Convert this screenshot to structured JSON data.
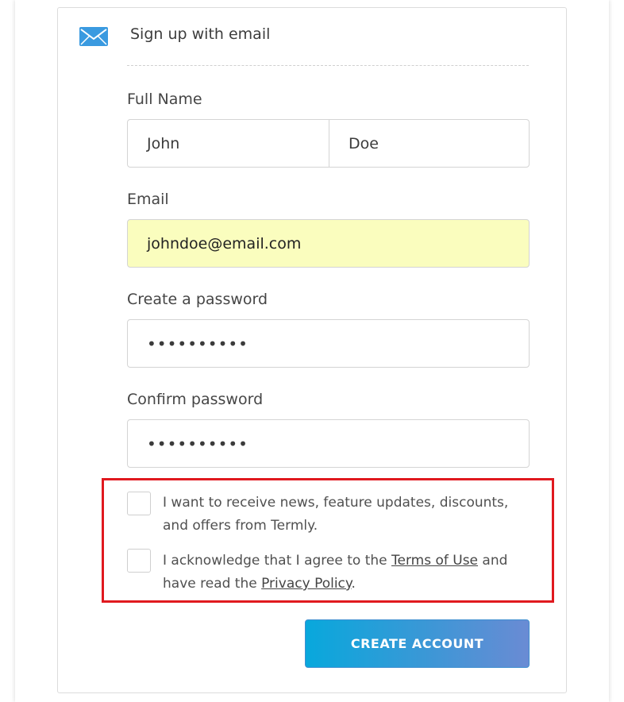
{
  "header": {
    "icon": "mail-icon",
    "title": "Sign up with email"
  },
  "form": {
    "full_name_label": "Full Name",
    "first_name_value": "John",
    "last_name_value": "Doe",
    "email_label": "Email",
    "email_value": "johndoe@email.com",
    "password_label": "Create a password",
    "password_value": "••••••••••",
    "confirm_label": "Confirm password",
    "confirm_value": "••••••••••"
  },
  "consent": {
    "newsletter_text": "I want to receive news, feature updates, discounts, and offers from Termly.",
    "terms_prefix": "I acknowledge that I agree to the ",
    "terms_link": "Terms of Use",
    "terms_middle": " and have read the ",
    "privacy_link": "Privacy Policy",
    "terms_suffix": ".",
    "highlight_color": "#e0191f"
  },
  "actions": {
    "submit_label": "CREATE ACCOUNT"
  },
  "colors": {
    "accent_start": "#08a8dc",
    "accent_end": "#6a8bd4",
    "autofill_bg": "#fafdbe",
    "mail_icon": "#3a9ae0"
  }
}
